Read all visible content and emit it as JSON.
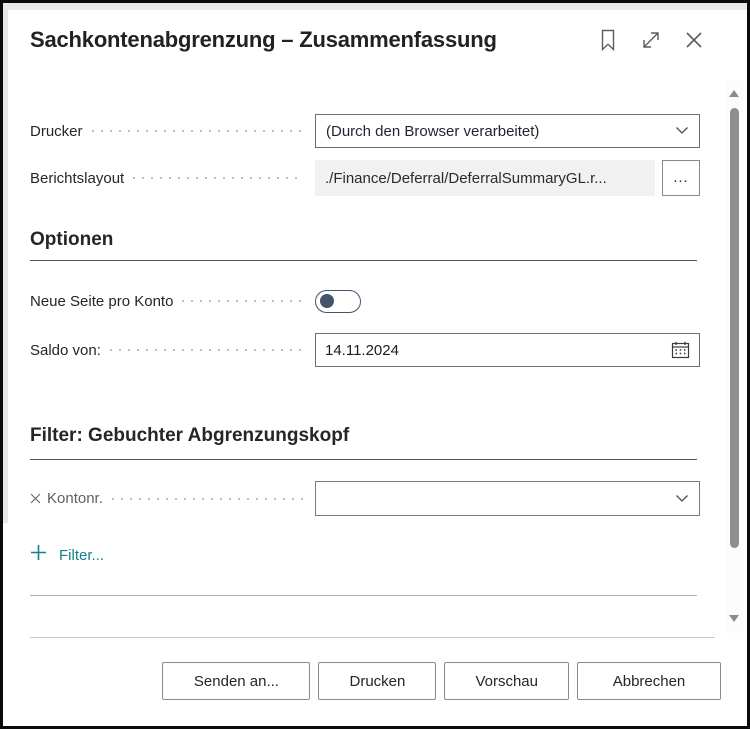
{
  "dialog": {
    "title": "Sachkontenabgrenzung – Zusammenfassung"
  },
  "fields": {
    "printer": {
      "label": "Drucker",
      "value": "(Durch den Browser verarbeitet)"
    },
    "report_layout": {
      "label": "Berichtslayout",
      "value": "./Finance/Deferral/DeferralSummaryGL.r...",
      "more_label": "…"
    }
  },
  "options_section": {
    "heading": "Optionen",
    "new_page_per_account": {
      "label": "Neue Seite pro Konto",
      "state": "off"
    },
    "balance_as_of": {
      "label": "Saldo von:",
      "value": "14.11.2024"
    }
  },
  "filter_section": {
    "heading": "Filter: Gebuchter Abgrenzungskopf",
    "rows": [
      {
        "label": "Kontonr.",
        "value": ""
      }
    ],
    "add_filter_label": "Filter..."
  },
  "footer": {
    "buttons": [
      "Senden an...",
      "Drucken",
      "Vorschau",
      "Abbrechen"
    ]
  },
  "icons": {
    "header": [
      "bookmark-icon",
      "expand-icon",
      "close-icon"
    ],
    "printer_field": "chevron-down-icon",
    "date_field": "calendar-icon",
    "filter_row": [
      "remove-filter-icon",
      "chevron-down-icon"
    ],
    "add_filter": "plus-icon"
  },
  "colors": {
    "accent_teal": "#17808a",
    "toggle_navy": "#44546a",
    "divider_blue_gray": "#a9b3bd"
  }
}
